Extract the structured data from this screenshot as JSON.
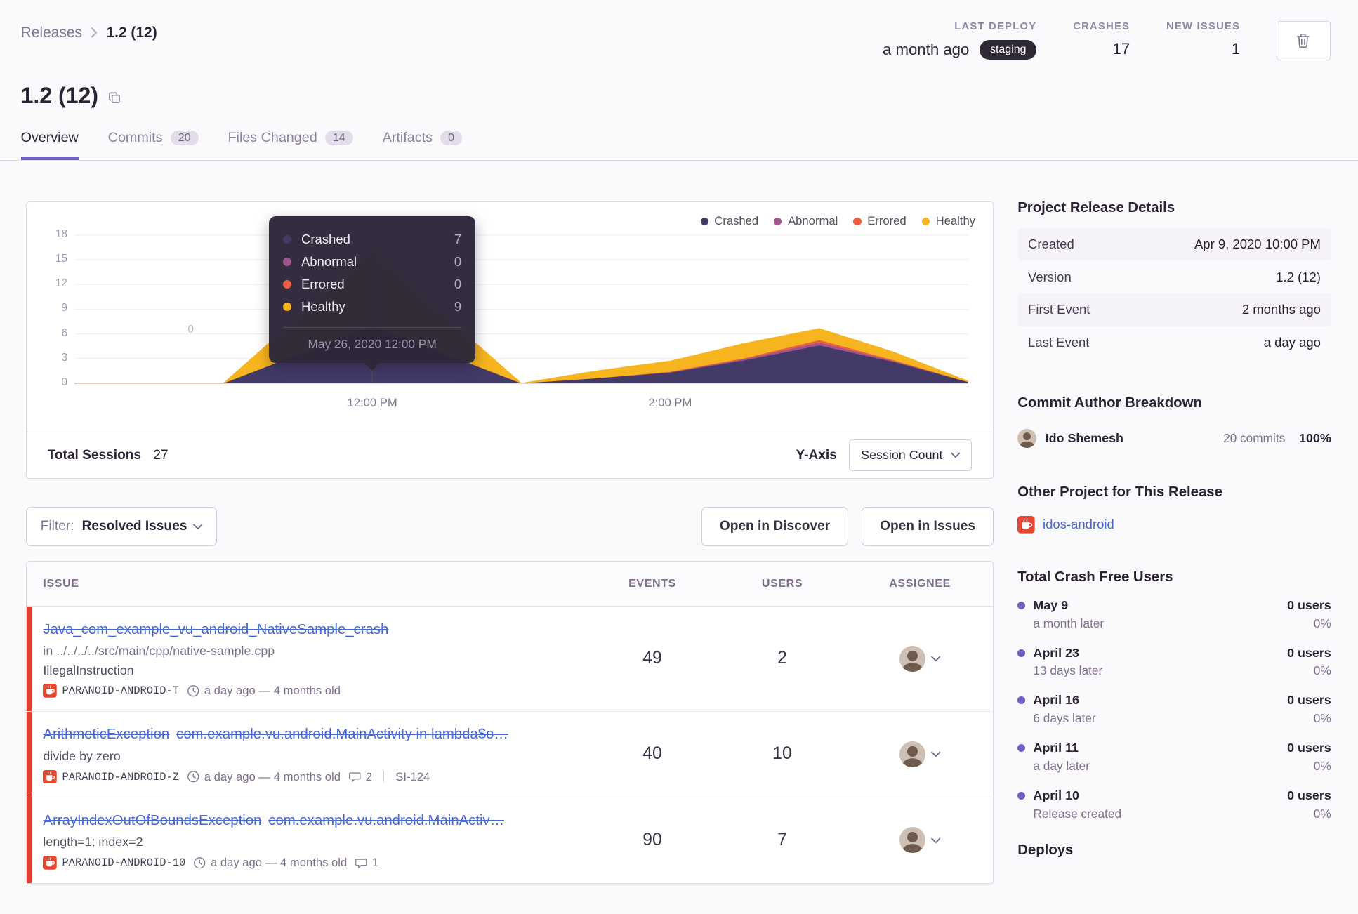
{
  "breadcrumb": {
    "parent": "Releases",
    "current": "1.2 (12)"
  },
  "header_stats": {
    "last_deploy": {
      "label": "LAST DEPLOY",
      "value": "a month ago",
      "env": "staging"
    },
    "crashes": {
      "label": "CRASHES",
      "value": "17"
    },
    "new_issues": {
      "label": "NEW ISSUES",
      "value": "1"
    }
  },
  "page": {
    "title": "1.2 (12)"
  },
  "tabs": [
    {
      "label": "Overview"
    },
    {
      "label": "Commits",
      "count": "20"
    },
    {
      "label": "Files Changed",
      "count": "14"
    },
    {
      "label": "Artifacts",
      "count": "0"
    }
  ],
  "sessions_card": {
    "total_sessions_label": "Total Sessions",
    "total_sessions_value": "27",
    "y_axis_label": "Y-Axis",
    "y_axis_value": "Session Count",
    "float_zero": "0",
    "tooltip": {
      "date": "May 26, 2020 12:00 PM",
      "rows": [
        {
          "name": "Crashed",
          "value": "7"
        },
        {
          "name": "Abnormal",
          "value": "0"
        },
        {
          "name": "Errored",
          "value": "0"
        },
        {
          "name": "Healthy",
          "value": "9"
        }
      ]
    }
  },
  "chart_data": {
    "type": "area",
    "stacked": true,
    "title": "Release sessions over time",
    "x_hours": [
      10,
      10.5,
      11,
      11.5,
      12,
      12.5,
      13,
      13.5,
      14,
      14.5,
      15,
      15.5,
      16
    ],
    "x_tick_labels": [
      {
        "hour": 12,
        "label": "12:00 PM"
      },
      {
        "hour": 14,
        "label": "2:00 PM"
      }
    ],
    "yticks": [
      0,
      3,
      6,
      9,
      12,
      15,
      18
    ],
    "ylim": [
      0,
      18
    ],
    "legend_position": "top-right",
    "tooltip_point": {
      "x": "May 26, 2020 12:00 PM",
      "Crashed": 7,
      "Abnormal": 0,
      "Errored": 0,
      "Healthy": 9
    },
    "series": [
      {
        "name": "Crashed",
        "color": "#433a67",
        "values": [
          0,
          0,
          0,
          3.5,
          7,
          3.5,
          0,
          0.6,
          1.3,
          2.8,
          4.6,
          2.6,
          0.15
        ]
      },
      {
        "name": "Abnormal",
        "color": "#a0548d",
        "values": [
          0,
          0,
          0,
          0,
          0,
          0,
          0,
          0,
          0.05,
          0.15,
          0.35,
          0.1,
          0
        ]
      },
      {
        "name": "Errored",
        "color": "#ec5e44",
        "values": [
          0,
          0,
          0,
          0,
          0,
          0,
          0,
          0,
          0.05,
          0.1,
          0.3,
          0.1,
          0
        ]
      },
      {
        "name": "Healthy",
        "color": "#f6b51e",
        "values": [
          0,
          0,
          0,
          4.5,
          9,
          4.5,
          0,
          0.9,
          1.3,
          1.8,
          1.4,
          1.0,
          0.1
        ]
      }
    ]
  },
  "filter_bar": {
    "filter_label": "Filter:",
    "filter_value": "Resolved Issues",
    "open_discover": "Open in Discover",
    "open_issues": "Open in Issues"
  },
  "issues_table": {
    "columns": [
      "ISSUE",
      "EVENTS",
      "USERS",
      "ASSIGNEE"
    ],
    "rows": [
      {
        "title": "Java_com_example_vu_android_NativeSample_crash",
        "location": "in ../../../../src/main/cpp/native-sample.cpp",
        "message": "IllegalInstruction",
        "device": "PARANOID-ANDROID-T",
        "age": "a day ago — 4 months old",
        "events": "49",
        "users": "2"
      },
      {
        "title": "ArithmeticException",
        "culprit": "com.example.vu.android.MainActivity in lambda$o…",
        "message": "divide by zero",
        "device": "PARANOID-ANDROID-Z",
        "age": "a day ago — 4 months old",
        "comments": "2",
        "short_id": "SI-124",
        "events": "40",
        "users": "10"
      },
      {
        "title": "ArrayIndexOutOfBoundsException",
        "culprit": "com.example.vu.android.MainActiv…",
        "message": "length=1; index=2",
        "device": "PARANOID-ANDROID-10",
        "age": "a day ago — 4 months old",
        "comments": "1",
        "events": "90",
        "users": "7"
      }
    ]
  },
  "sidebar": {
    "release_details": {
      "heading": "Project Release Details",
      "rows": [
        {
          "key": "Created",
          "value": "Apr 9, 2020 10:00 PM"
        },
        {
          "key": "Version",
          "value": "1.2 (12)"
        },
        {
          "key": "First Event",
          "value": "2 months ago"
        },
        {
          "key": "Last Event",
          "value": "a day ago"
        }
      ]
    },
    "commit_authors": {
      "heading": "Commit Author Breakdown",
      "author": {
        "name": "Ido Shemesh",
        "commits": "20 commits",
        "percent": "100%"
      }
    },
    "other_projects": {
      "heading": "Other Project for This Release",
      "project": "idos-android"
    },
    "crash_free": {
      "heading": "Total Crash Free Users",
      "items": [
        {
          "date": "May 9",
          "note": "a month later",
          "users": "0 users",
          "percent": "0%"
        },
        {
          "date": "April 23",
          "note": "13 days later",
          "users": "0 users",
          "percent": "0%"
        },
        {
          "date": "April 16",
          "note": "6 days later",
          "users": "0 users",
          "percent": "0%"
        },
        {
          "date": "April 11",
          "note": "a day later",
          "users": "0 users",
          "percent": "0%"
        },
        {
          "date": "April 10",
          "note": "Release created",
          "users": "0 users",
          "percent": "0%"
        }
      ]
    },
    "deploys_heading": "Deploys"
  },
  "colors": {
    "accent_purple": "#6c5fc7",
    "link_blue": "#4767d6",
    "resolved_red": "#e03e2f",
    "badge_dark": "#2f2936",
    "crashed": "#433a67",
    "abnormal": "#a0548d",
    "errored": "#ec5e44",
    "healthy": "#f6b51e"
  }
}
